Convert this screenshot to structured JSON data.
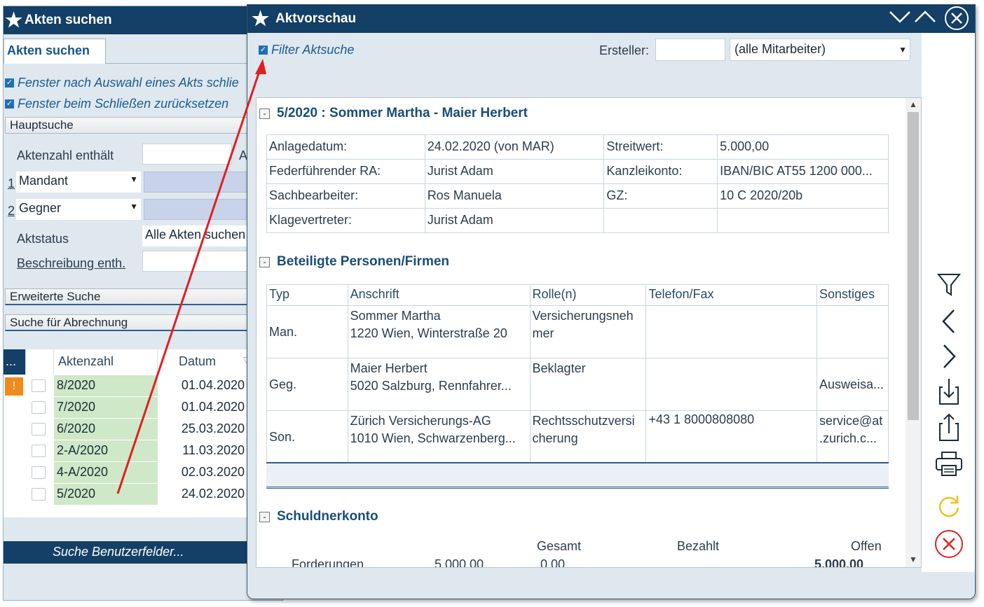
{
  "back_window": {
    "title": "Akten suchen",
    "tab_label": "Akten suchen",
    "options": [
      "Fenster nach Auswahl eines Akts schlie",
      "Fenster beim Schließen zurücksetzen"
    ],
    "main_search_label": "Hauptsuche",
    "aktenzahl_label": "Aktenzahl enthält",
    "aktenzahl_value": "",
    "aktenzahl_extra": "A",
    "mandant_prefix": "1",
    "mandant_label": "Mandant",
    "gegner_prefix": "2",
    "gegner_label": "Gegner",
    "aktstatus_label": "Aktstatus",
    "aktstatus_value": "Alle Akten suchen",
    "beschreibung_label": "Beschreibung enth.",
    "extended_search_label": "Erweiterte Suche",
    "billing_search_label": "Suche für Abrechnung",
    "results": {
      "col_more": "...",
      "col_aktenzahl": "Aktenzahl",
      "col_datum": "Datum",
      "rows": [
        {
          "aktenzahl": "8/2020",
          "datum": "01.04.2020"
        },
        {
          "aktenzahl": "7/2020",
          "datum": "01.04.2020"
        },
        {
          "aktenzahl": "6/2020",
          "datum": "25.03.2020"
        },
        {
          "aktenzahl": "2-A/2020",
          "datum": "11.03.2020"
        },
        {
          "aktenzahl": "4-A/2020",
          "datum": "02.03.2020"
        },
        {
          "aktenzahl": "5/2020",
          "datum": "24.02.2020"
        }
      ]
    },
    "user_fields_button": "Suche Benutzerfelder..."
  },
  "front_window": {
    "title": "Aktvorschau",
    "filter_label": "Filter Aktsuche",
    "ersteller_label": "Ersteller:",
    "ersteller_value": "",
    "mitarbeiter_value": "(alle Mitarbeiter)",
    "case_header": "5/2020 : Sommer Martha - Maier Herbert",
    "info": {
      "anlagedatum_label": "Anlagedatum:",
      "anlagedatum_value": "24.02.2020 (von MAR)",
      "streitwert_label": "Streitwert:",
      "streitwert_value": "5.000,00",
      "ffra_label": "Federführender RA:",
      "ffra_value": "Jurist Adam",
      "konto_label": "Kanzleikonto:",
      "konto_value": "IBAN/BIC AT55 1200 000...",
      "sb_label": "Sachbearbeiter:",
      "sb_value": "Ros Manuela",
      "gz_label": "GZ:",
      "gz_value": "10 C 2020/20b",
      "kv_label": "Klagevertreter:",
      "kv_value": "Jurist Adam"
    },
    "persons_header": "Beteiligte Personen/Firmen",
    "persons_columns": [
      "Typ",
      "Anschrift",
      "Rolle(n)",
      "Telefon/Fax",
      "Sonstiges"
    ],
    "persons": [
      {
        "typ": "Man.",
        "anschrift": "Sommer Martha\n1220 Wien, Winterstraße 20",
        "rolle": "Versicherungsneh\nmer",
        "telefon": "",
        "sonstiges": ""
      },
      {
        "typ": "Geg.",
        "anschrift": "Maier Herbert\n5020 Salzburg, Rennfahrer...",
        "rolle": "Beklagter",
        "telefon": "",
        "sonstiges": "Ausweisa..."
      },
      {
        "typ": "Son.",
        "anschrift": "Zürich Versicherungs-AG\n1010 Wien, Schwarzenberg...",
        "rolle": "Rechtsschutzversi\ncherung",
        "telefon": "+43 1 8000808080",
        "sonstiges": "service@at\n.zurich.c..."
      }
    ],
    "debt_header": "Schuldnerkonto",
    "debt_columns": {
      "gesamt": "Gesamt",
      "bezahlt": "Bezahlt",
      "offen": "Offen"
    },
    "debt_row": {
      "label": "Forderungen",
      "gesamt": "5.000,00",
      "bezahlt": "0,00",
      "offen": "5.000,00"
    },
    "toolbar": [
      "filter-icon",
      "chevron-left-icon",
      "chevron-right-icon",
      "import-icon",
      "export-icon",
      "print-icon",
      "refresh-icon",
      "cancel-icon"
    ]
  },
  "colors": {
    "titlebar": "#143f66",
    "accent_blue": "#1a4d7a",
    "row_green": "#cfe8c7",
    "arrow_red": "#e02020",
    "refresh_yellow": "#f0c020",
    "cancel_red": "#e02020"
  }
}
